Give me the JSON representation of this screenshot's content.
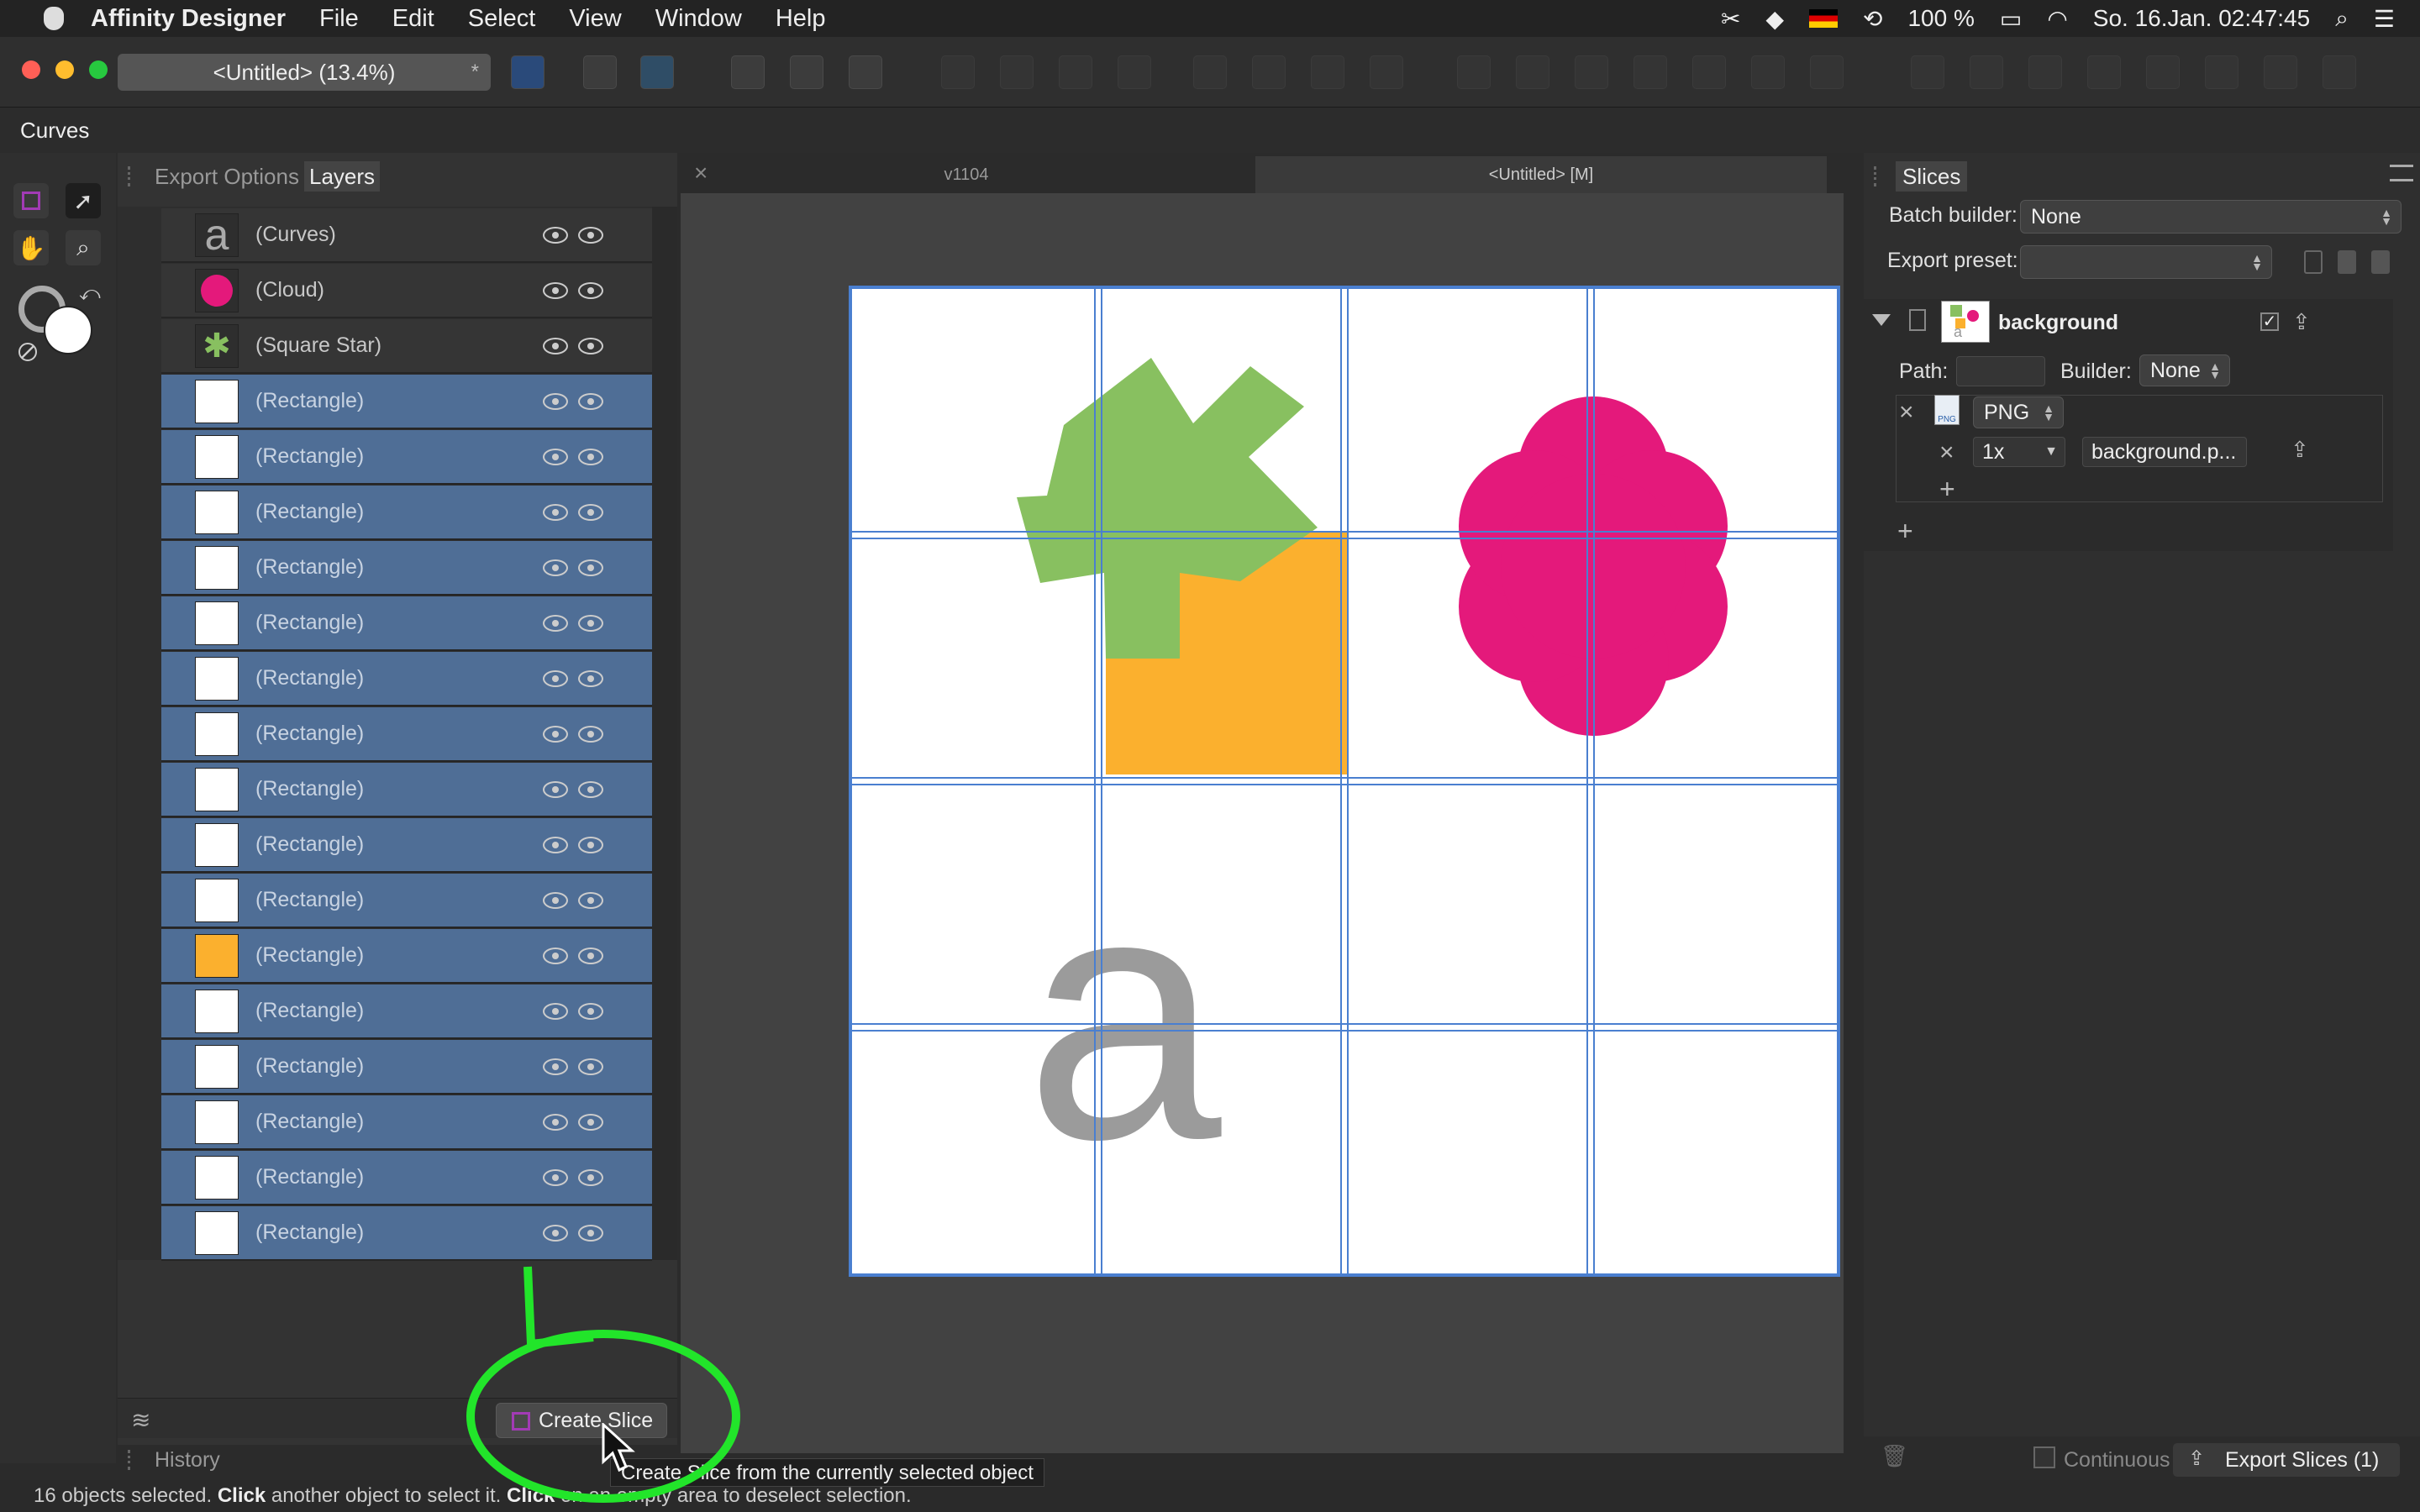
{
  "menubar": {
    "app_name": "Affinity Designer",
    "items": [
      "File",
      "Edit",
      "Select",
      "View",
      "Window",
      "Help"
    ],
    "battery": "100 %",
    "datetime": "So. 16.Jan. 02:47:45"
  },
  "document": {
    "tab_title": "<Untitled> (13.4%)",
    "modified_mark": "*"
  },
  "context": {
    "tool_name": "Curves"
  },
  "left_panel": {
    "tabs": [
      "Export Options",
      "Layers"
    ],
    "active_tab": "Layers",
    "layers": [
      {
        "name": "(Curves)",
        "thumb": "letter-a",
        "selected": false
      },
      {
        "name": "(Cloud)",
        "thumb": "cloud",
        "selected": false
      },
      {
        "name": "(Square Star)",
        "thumb": "star",
        "selected": false
      },
      {
        "name": "(Rectangle)",
        "thumb": "white",
        "selected": true
      },
      {
        "name": "(Rectangle)",
        "thumb": "white",
        "selected": true
      },
      {
        "name": "(Rectangle)",
        "thumb": "white",
        "selected": true
      },
      {
        "name": "(Rectangle)",
        "thumb": "white",
        "selected": true
      },
      {
        "name": "(Rectangle)",
        "thumb": "white",
        "selected": true
      },
      {
        "name": "(Rectangle)",
        "thumb": "white",
        "selected": true
      },
      {
        "name": "(Rectangle)",
        "thumb": "white",
        "selected": true
      },
      {
        "name": "(Rectangle)",
        "thumb": "white",
        "selected": true
      },
      {
        "name": "(Rectangle)",
        "thumb": "white",
        "selected": true
      },
      {
        "name": "(Rectangle)",
        "thumb": "white",
        "selected": true
      },
      {
        "name": "(Rectangle)",
        "thumb": "orange",
        "selected": true
      },
      {
        "name": "(Rectangle)",
        "thumb": "white",
        "selected": true
      },
      {
        "name": "(Rectangle)",
        "thumb": "white",
        "selected": true
      },
      {
        "name": "(Rectangle)",
        "thumb": "white",
        "selected": true
      },
      {
        "name": "(Rectangle)",
        "thumb": "white",
        "selected": true
      },
      {
        "name": "(Rectangle)",
        "thumb": "white",
        "selected": true
      }
    ],
    "create_slice_label": "Create Slice",
    "history_label": "History"
  },
  "tooltip": "Create Slice from the currently selected object",
  "canvas": {
    "tabs": [
      "v1104",
      "<Untitled> [M]"
    ],
    "glyph": "a"
  },
  "right_panel": {
    "tab": "Slices",
    "batch_builder_label": "Batch builder:",
    "batch_builder_value": "None",
    "export_preset_label": "Export preset:",
    "export_preset_value": "",
    "slice_name": "background",
    "path_label": "Path:",
    "path_value": "",
    "builder_label": "Builder:",
    "builder_value": "None",
    "format": "PNG",
    "scale": "1x",
    "filename": "background.p...",
    "continuous_label": "Continuous",
    "export_slices_label": "Export Slices (1)"
  },
  "status": {
    "prefix": "16 objects selected.",
    "click": "Click",
    "mid": "another object to select it.",
    "click2": "Click",
    "suffix": "on an empty area to deselect selection."
  },
  "colors": {
    "selection": "#4f6e96",
    "highlight": "#22e52a",
    "star": "#88c060",
    "square": "#fbb02e",
    "cloud": "#e4197b",
    "glyph": "#9b9b9b",
    "slice_grid": "#4a7fd0"
  }
}
